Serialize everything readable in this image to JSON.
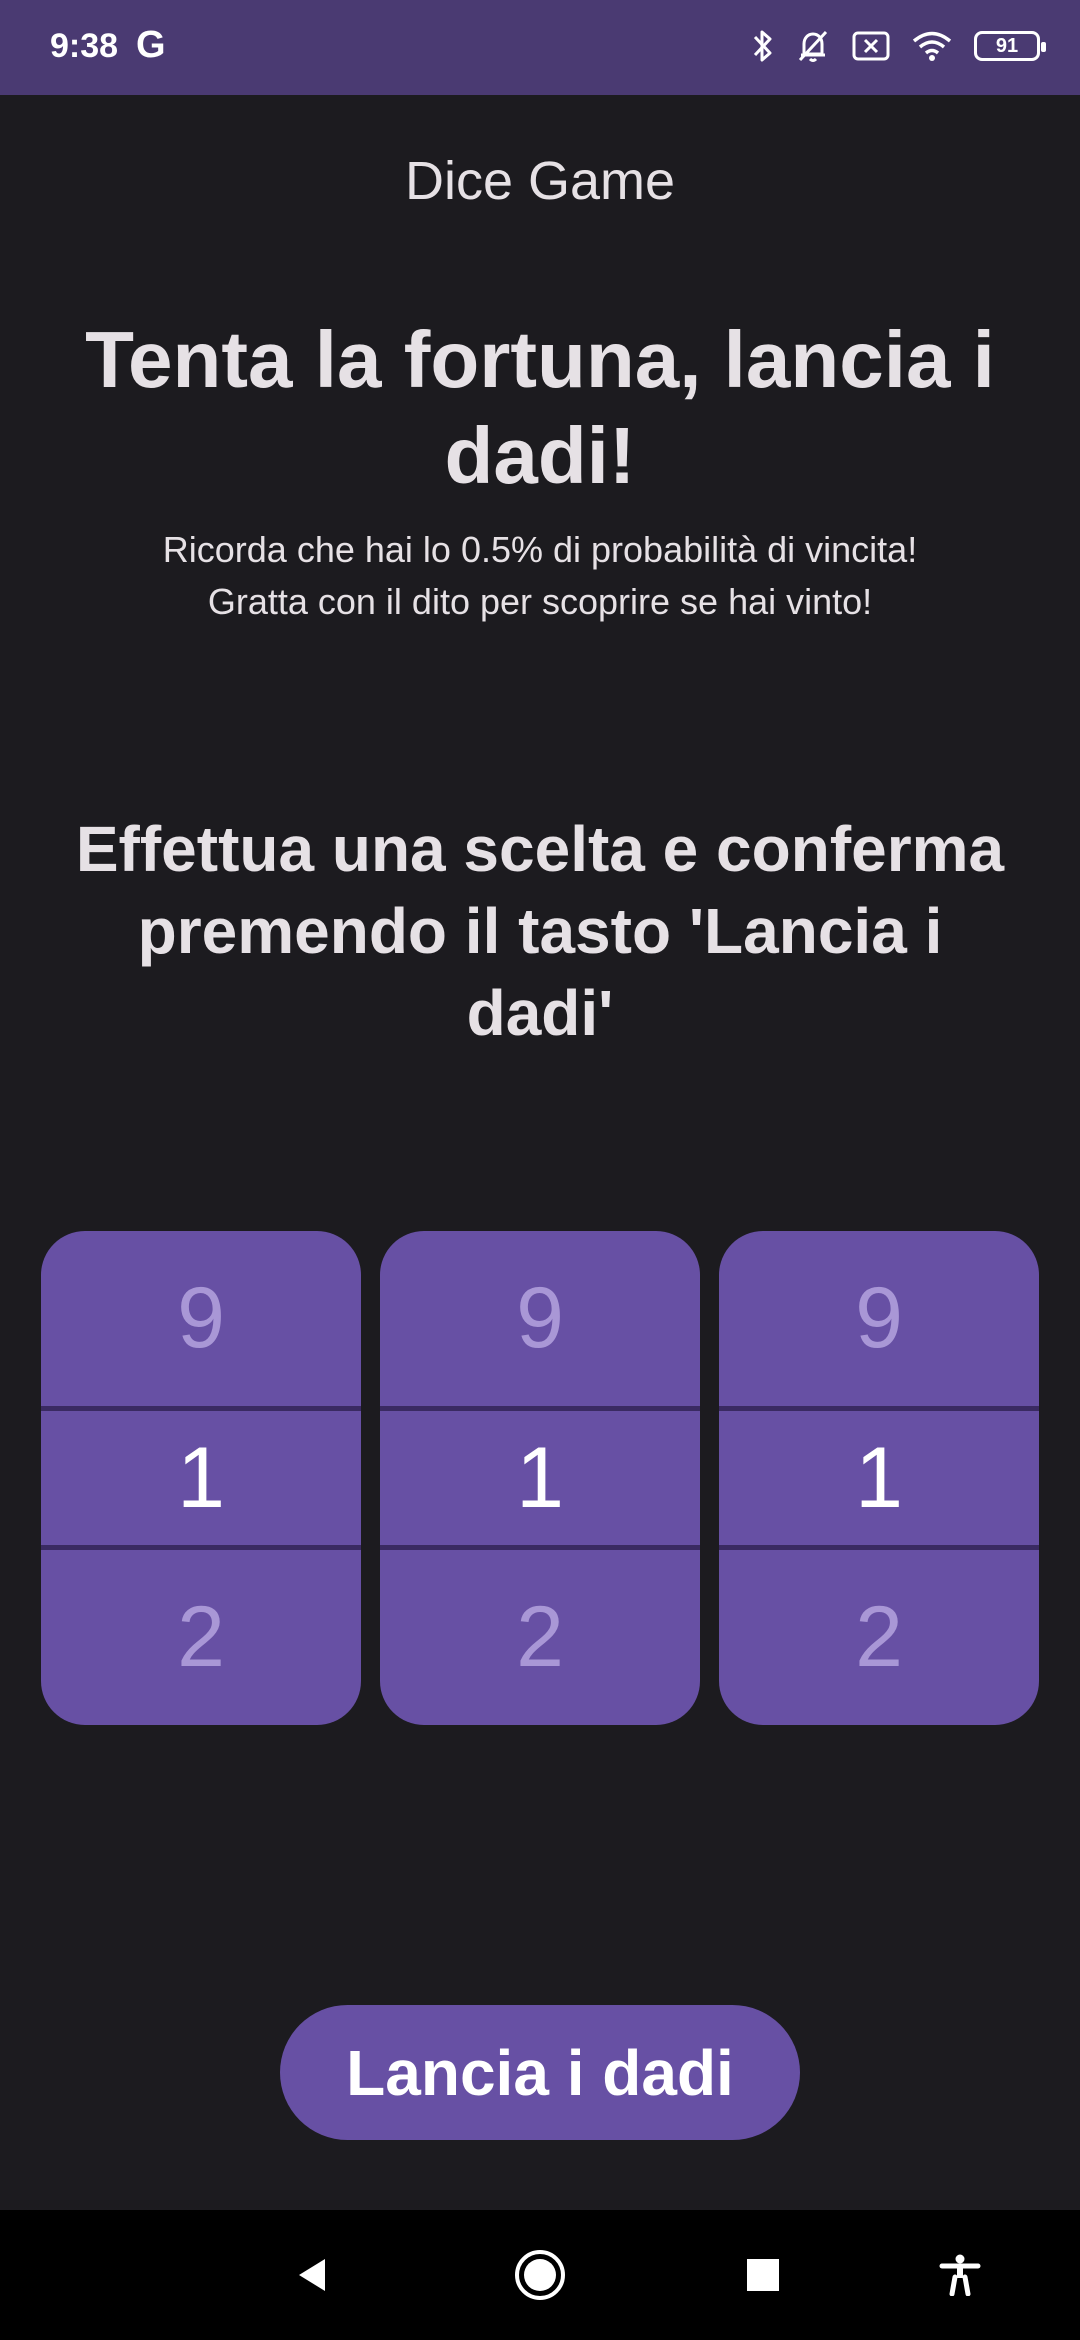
{
  "status_bar": {
    "time": "9:38",
    "google_letter": "G",
    "battery": "91",
    "icons": [
      "bluetooth-icon",
      "bell-off-icon",
      "no-sim-icon",
      "wifi-icon",
      "battery-icon"
    ]
  },
  "app": {
    "title": "Dice Game"
  },
  "main": {
    "headline": "Tenta la fortuna, lancia i dadi!",
    "subtitle_line1": "Ricorda che hai lo 0.5% di probabilità di vincita!",
    "subtitle_line2": "Gratta con il dito per scoprire se hai vinto!",
    "instruction": "Effettua una scelta e conferma premendo il tasto 'Lancia i dadi'"
  },
  "pickers": [
    {
      "prev": "9",
      "selected": "1",
      "next": "2"
    },
    {
      "prev": "9",
      "selected": "1",
      "next": "2"
    },
    {
      "prev": "9",
      "selected": "1",
      "next": "2"
    }
  ],
  "roll_button": {
    "label": "Lancia i dadi"
  },
  "nav_bar": {
    "icons": [
      "back-icon",
      "home-icon",
      "recents-icon",
      "accessibility-icon"
    ]
  },
  "colors": {
    "status_bar": "#4a3a72",
    "background": "#1c1b1f",
    "accent": "#6750a4",
    "text": "#e6e1e5"
  }
}
